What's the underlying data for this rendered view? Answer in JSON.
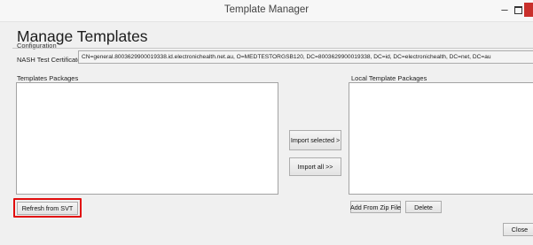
{
  "window": {
    "title": "Template Manager"
  },
  "heading": "Manage Templates",
  "subheading": "Configuration",
  "certificate": {
    "label": "NASH Test Certificate",
    "value": "CN=general.8003629900019338.id.electronichealth.net.au, O=MEDTESTORGSB120, DC=8003629900019338, DC=id, DC=electronichealth, DC=net, DC=au"
  },
  "templates_packages": {
    "label": "Templates Packages",
    "items": []
  },
  "local_template_packages": {
    "label": "Local Template Packages",
    "items": []
  },
  "buttons": {
    "import_selected": "Import selected >",
    "import_all": "Import all >>",
    "refresh": "Refresh from SVT",
    "add_zip": "Add From Zip File",
    "delete": "Delete",
    "close": "Close"
  },
  "colors": {
    "highlight": "#e10d0d",
    "window_close": "#c9302c",
    "background": "#f0f0f0"
  }
}
